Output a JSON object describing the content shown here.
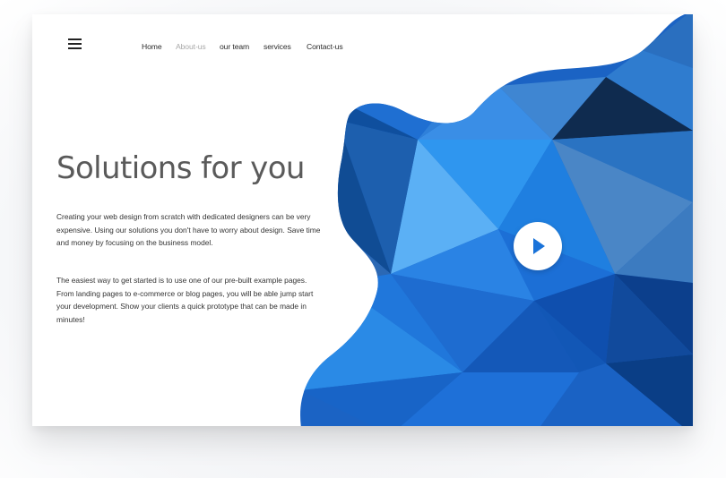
{
  "nav": {
    "menu_icon": "hamburger-menu-icon",
    "items": [
      {
        "label": "Home",
        "active": false
      },
      {
        "label": "About-us",
        "active": true
      },
      {
        "label": "our team",
        "active": false
      },
      {
        "label": "services",
        "active": false
      },
      {
        "label": "Contact-us",
        "active": false
      }
    ]
  },
  "hero": {
    "title": "Solutions for you",
    "paragraph_1": "Creating your web design from scratch with dedicated designers can be very expensive. Using our solutions you don't have to worry about design. Save time and money by focusing on the business model.",
    "paragraph_2": "The easiest way to get started is to use one of our pre-built example pages. From landing pages to e-commerce or blog pages, you will be able jump start your development. Show your clients a quick prototype that can be made in minutes!"
  },
  "media": {
    "play_icon": "play-icon",
    "accent_color": "#1a73d9",
    "graphic": "blue-low-poly-blob"
  },
  "colors": {
    "nav_active": "#a8a8a8",
    "title": "#5a5a5a",
    "body_text": "#333333",
    "blue_dark": "#0d3a6e",
    "blue_mid": "#1a6fd0",
    "blue_light": "#5aa9ef"
  }
}
